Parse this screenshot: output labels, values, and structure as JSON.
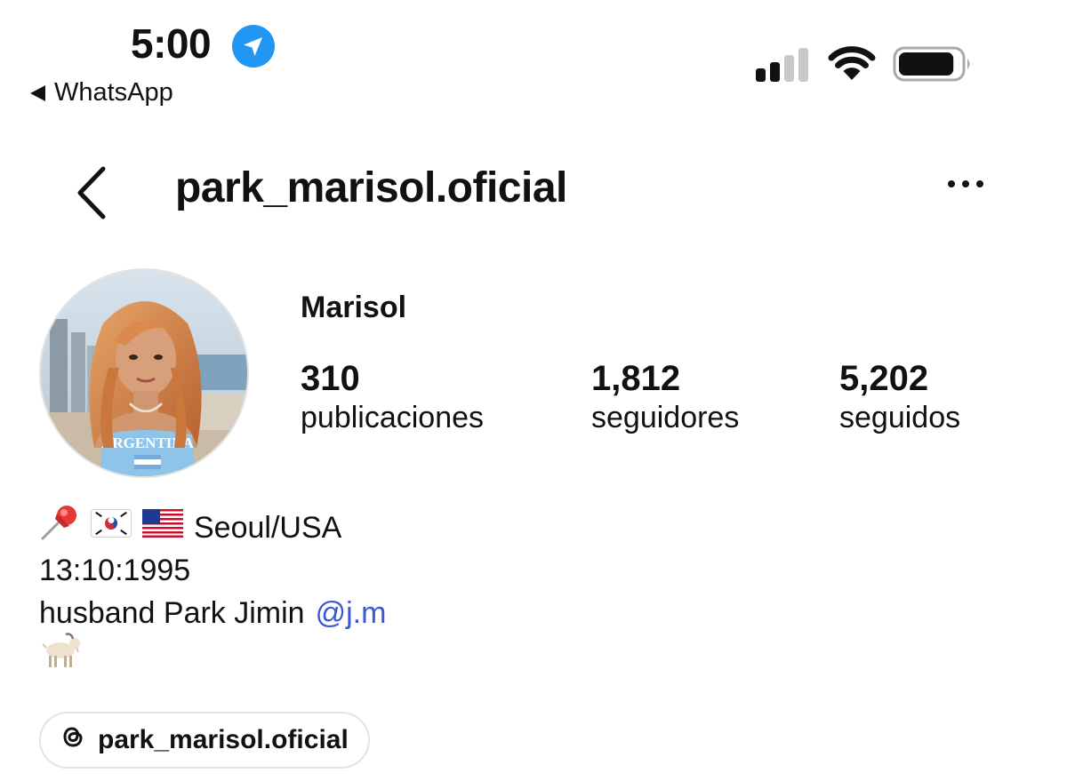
{
  "status_bar": {
    "time": "5:00",
    "back_app": "WhatsApp",
    "icons": [
      "location-arrow-icon",
      "cellular-signal-icon",
      "wifi-icon",
      "battery-icon"
    ],
    "signal_bars_active": 2,
    "signal_bars_total": 4,
    "battery_level": 0.9
  },
  "header": {
    "username": "park_marisol.oficial",
    "icons": [
      "back-chevron-icon",
      "more-options-icon"
    ]
  },
  "profile": {
    "display_name": "Marisol",
    "avatar_jersey_text": "ARGENTINA",
    "stats": [
      {
        "value": "310",
        "label": "publicaciones"
      },
      {
        "value": "1,812",
        "label": "seguidores"
      },
      {
        "value": "5,202",
        "label": "seguidos"
      }
    ]
  },
  "bio": {
    "line1_icons": [
      "pushpin-emoji",
      "south-korea-flag-emoji",
      "usa-flag-emoji"
    ],
    "line1_text": "Seoul/USA",
    "line2": "13:10:1995",
    "line3_text": "husband Park Jimin",
    "line3_mention": "@j.m",
    "line4_icons": [
      "goat-emoji"
    ]
  },
  "threads_link": {
    "icon": "threads-icon",
    "label": "park_marisol.oficial"
  },
  "colors": {
    "location_badge": "#2196f3",
    "mention": "#3858d6",
    "text": "#111111",
    "chip_border": "#e3e3e3"
  }
}
